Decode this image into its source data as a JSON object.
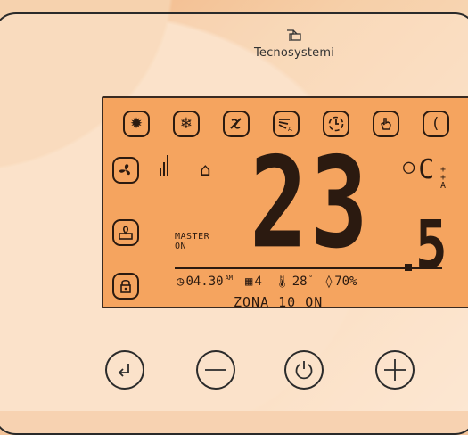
{
  "brand": {
    "name": "Tecnosystemi"
  },
  "lcd": {
    "top_icons": [
      "sun-heat-icon",
      "snowflake-cool-icon",
      "fan-off-icon",
      "auto-fan-icon",
      "clock-program-icon",
      "hand-manual-icon"
    ],
    "temperature_main": "23",
    "temperature_decimal": "5",
    "unit": "C",
    "master_label": "MASTER",
    "master_state": "ON",
    "time": "04.30",
    "time_suffix": "AM",
    "day": "4",
    "external_temp": "28",
    "external_temp_unit": "°",
    "humidity": "70%",
    "zone_status": "ZONA 10 ON",
    "auto_label_plus": "+",
    "auto_label_a": "A"
  },
  "controls": [
    "enter-button",
    "minus-button",
    "power-button",
    "plus-button"
  ],
  "colors": {
    "lcd_background": "#f5a45f",
    "lcd_ink": "#2b1a10",
    "body": "#f6d2ae"
  }
}
